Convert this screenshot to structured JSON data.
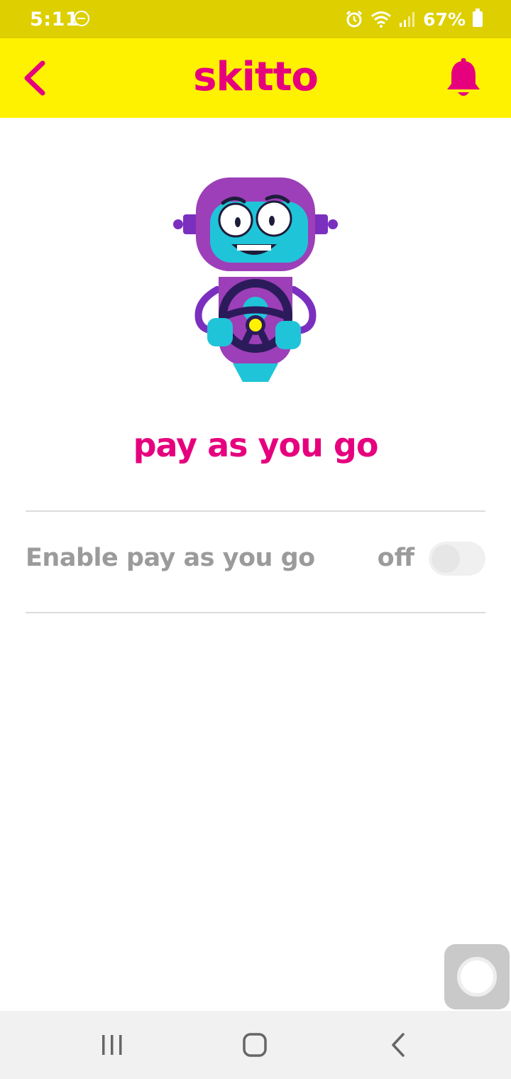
{
  "status_bar": {
    "time": "5:11",
    "battery": "67%",
    "color": "#ddcf00"
  },
  "header": {
    "brand": "skitto",
    "background": "#fff200",
    "accent": "#e6007e",
    "back_icon": "chevron-left-icon",
    "notification_icon": "bell-icon"
  },
  "page": {
    "title": "pay as you go",
    "illustration": "robot-driver"
  },
  "setting": {
    "label": "Enable pay as you go",
    "state_text": "off",
    "enabled": false
  },
  "nav_bar": {
    "recents_icon": "recents-icon",
    "home_icon": "home-icon",
    "back_icon": "back-icon"
  }
}
